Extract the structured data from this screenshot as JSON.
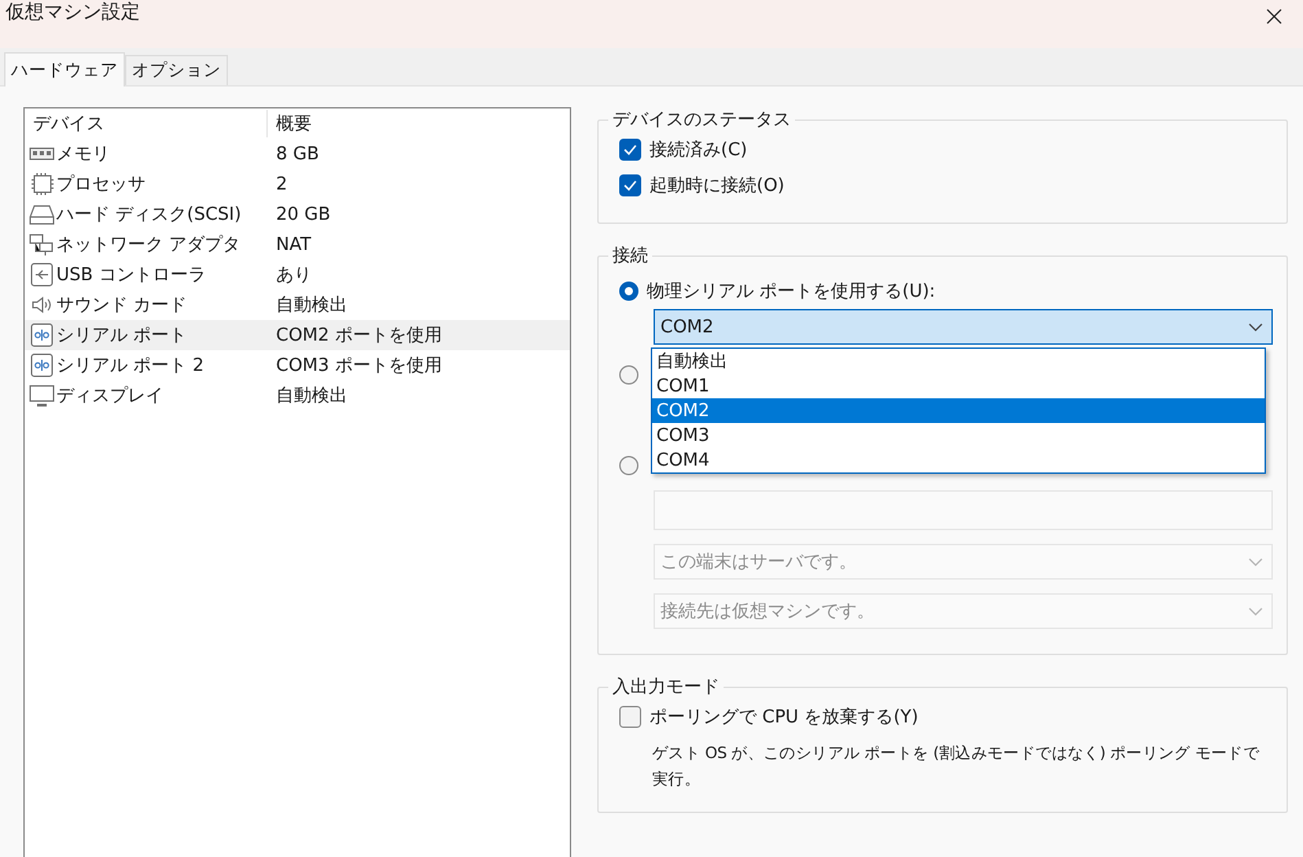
{
  "window": {
    "title": "仮想マシン設定"
  },
  "tabs": [
    {
      "label": "ハードウェア",
      "selected": true
    },
    {
      "label": "オプション",
      "selected": false
    }
  ],
  "device_table": {
    "columns": [
      "デバイス",
      "概要"
    ],
    "rows": [
      {
        "kind": "memory",
        "device": "メモリ",
        "summary": "8 GB",
        "selected": false
      },
      {
        "kind": "processor",
        "device": "プロセッサ",
        "summary": "2",
        "selected": false
      },
      {
        "kind": "disk",
        "device": "ハード ディスク(SCSI)",
        "summary": "20 GB",
        "selected": false
      },
      {
        "kind": "network",
        "device": "ネットワーク アダプタ",
        "summary": "NAT",
        "selected": false
      },
      {
        "kind": "usb",
        "device": "USB コントローラ",
        "summary": "あり",
        "selected": false
      },
      {
        "kind": "sound",
        "device": "サウンド カード",
        "summary": "自動検出",
        "selected": false
      },
      {
        "kind": "serial",
        "device": "シリアル ポート",
        "summary": "COM2 ポートを使用",
        "selected": true
      },
      {
        "kind": "serial",
        "device": "シリアル ポート 2",
        "summary": "COM3 ポートを使用",
        "selected": false
      },
      {
        "kind": "display",
        "device": "ディスプレイ",
        "summary": "自動検出",
        "selected": false
      }
    ]
  },
  "device_status": {
    "title": "デバイスのステータス",
    "options": [
      {
        "label": "接続済み(C)",
        "checked": true
      },
      {
        "label": "起動時に接続(O)",
        "checked": true
      }
    ]
  },
  "connection": {
    "title": "接続",
    "options": [
      {
        "label": "物理シリアル ポートを使用する(U):",
        "selected": true
      },
      {
        "selected": false
      },
      {
        "selected": false
      }
    ],
    "port_select": {
      "value": "COM2",
      "expanded": true,
      "options": [
        {
          "label": "自動検出",
          "selected": false
        },
        {
          "label": "COM1",
          "selected": false
        },
        {
          "label": "COM2",
          "selected": true
        },
        {
          "label": "COM3",
          "selected": false
        },
        {
          "label": "COM4",
          "selected": false
        }
      ]
    },
    "pipe_selects": [
      {
        "value": "この端末はサーバです。",
        "disabled": true
      },
      {
        "value": "接続先は仮想マシンです。",
        "disabled": true
      }
    ]
  },
  "io_mode": {
    "title": "入出力モード",
    "option": {
      "label": "ポーリングで CPU を放棄する(Y)",
      "checked": false
    },
    "description": "ゲスト OS が、このシリアル ポートを (割込みモードではなく) ポーリング モードで実行。"
  }
}
